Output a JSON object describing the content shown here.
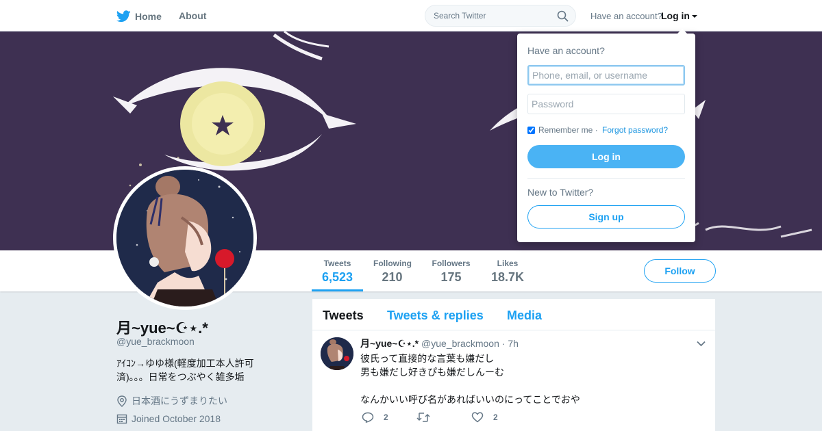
{
  "nav": {
    "home_label": "Home",
    "about_label": "About",
    "search_placeholder": "Search Twitter",
    "have_account": "Have an account?",
    "login_label": "Log in"
  },
  "login_dropdown": {
    "title": "Have an account?",
    "username_placeholder": "Phone, email, or username",
    "password_placeholder": "Password",
    "remember_label": "Remember me",
    "separator": " · ",
    "forgot_label": "Forgot password?",
    "login_button": "Log in",
    "new_prompt": "New to Twitter?",
    "signup_button": "Sign up"
  },
  "stats": [
    {
      "label": "Tweets",
      "value": "6,523"
    },
    {
      "label": "Following",
      "value": "210"
    },
    {
      "label": "Followers",
      "value": "175"
    },
    {
      "label": "Likes",
      "value": "18.7K"
    }
  ],
  "follow_button": "Follow",
  "profile": {
    "name": "月~yue~☪⋆.*",
    "handle": "@yue_brackmoon",
    "bio_line1": "ｱｲｺﾝ→ゆゆ様(軽度加工本人許可",
    "bio_line2": "済)。。。日常をつぶやく雑多垢",
    "location": "日本酒にうずまりたい",
    "joined": "Joined October 2018"
  },
  "timeline": {
    "tabs": [
      "Tweets",
      "Tweets & replies",
      "Media"
    ]
  },
  "tweet": {
    "name": "月~yue~☪⋆.*",
    "handle": "@yue_brackmoon",
    "separator": "·",
    "time": "7h",
    "lines": [
      "彼氏って直接的な言葉も嫌だし",
      "男も嫌だし好きぴも嫌だしんーむ",
      "",
      "なんかいい呼び名があればいいのにってことでおや"
    ],
    "reply_count": "2",
    "retweet_count": "",
    "like_count": "2"
  },
  "colors": {
    "accent": "#1da1f2",
    "banner": "#3e3052",
    "background": "#e6ecf0"
  },
  "icons": [
    "twitter-bird-icon",
    "search-icon",
    "location-icon",
    "calendar-icon",
    "chevron-down-icon",
    "reply-icon",
    "retweet-icon",
    "heart-icon"
  ]
}
